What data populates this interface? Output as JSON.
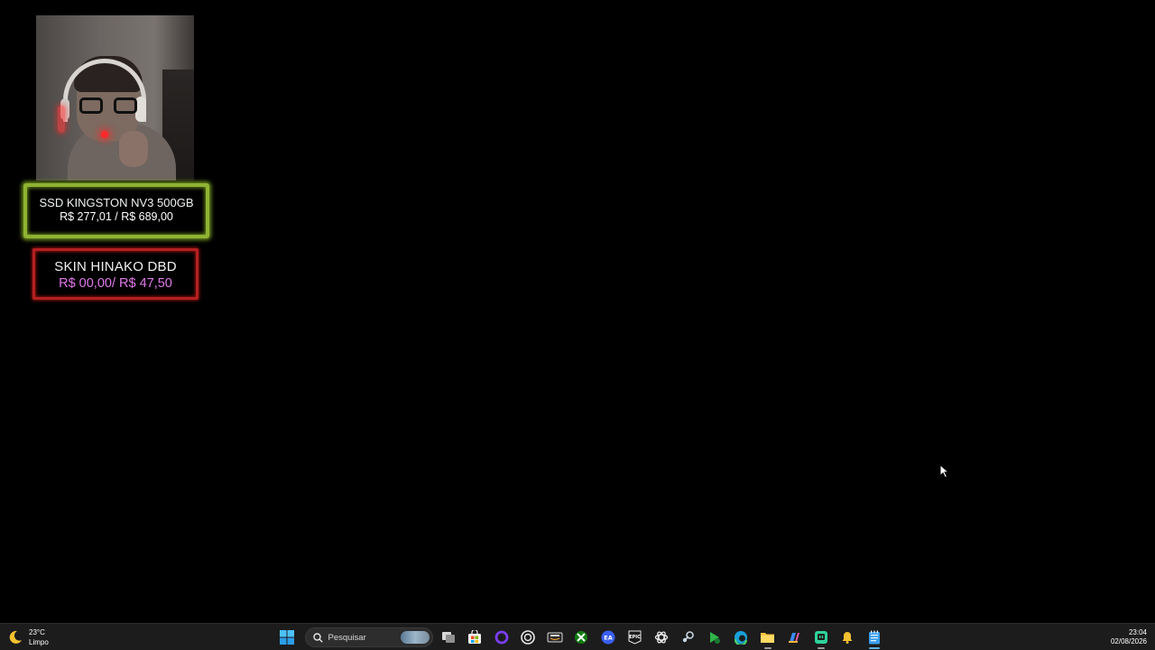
{
  "overlay": {
    "goals": [
      {
        "title": "SSD KINGSTON NV3 500GB",
        "amount": "R$ 277,01 / R$ 689,00",
        "border_color": "#8fb332",
        "amount_color": "#ffffff"
      },
      {
        "title": "SKIN HINAKO DBD",
        "amount": "R$ 00,00/ R$ 47,50",
        "border_color": "#b32020",
        "amount_color": "#e279ec"
      }
    ]
  },
  "taskbar": {
    "weather": {
      "icon": "moon-icon",
      "temperature": "23°C",
      "condition": "Limpo"
    },
    "search": {
      "placeholder": "Pesquisar"
    },
    "apps": [
      {
        "name": "start-icon"
      },
      {
        "name": "task-view-icon"
      },
      {
        "name": "microsoft-store-icon"
      },
      {
        "name": "cortana-ring-icon"
      },
      {
        "name": "ubisoft-icon"
      },
      {
        "name": "amazon-games-icon"
      },
      {
        "name": "xbox-icon"
      },
      {
        "name": "ea-app-icon"
      },
      {
        "name": "epic-games-icon"
      },
      {
        "name": "chatgpt-icon"
      },
      {
        "name": "steam-icon"
      },
      {
        "name": "game-launcher-icon"
      },
      {
        "name": "edge-icon"
      },
      {
        "name": "file-explorer-icon"
      },
      {
        "name": "copilot-icon"
      },
      {
        "name": "twitch-studio-icon"
      },
      {
        "name": "notification-bell-app-icon"
      },
      {
        "name": "notepad-icon"
      }
    ],
    "clock": {
      "time": "23:04",
      "date": "02/08/2026"
    }
  }
}
